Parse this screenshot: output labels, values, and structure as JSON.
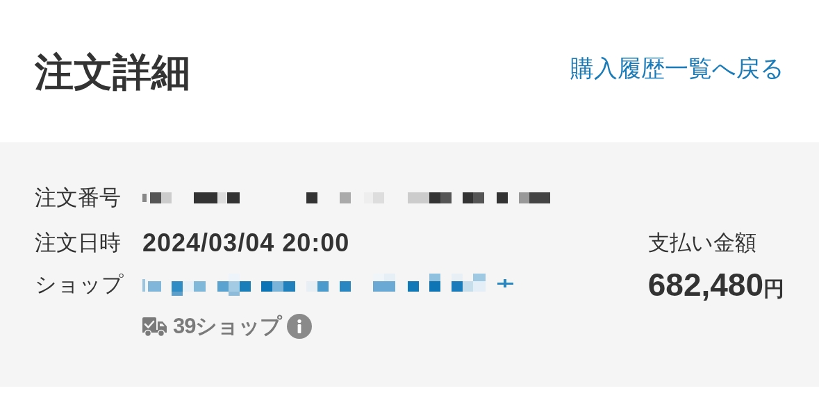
{
  "header": {
    "title": "注文詳細",
    "back_link": "購入履歴一覧へ戻る"
  },
  "order": {
    "fields": [
      {
        "kind": "redacted",
        "label": "注文番号"
      },
      {
        "kind": "text",
        "label": "注文日時",
        "value": "2024/03/04 20:00"
      },
      {
        "kind": "redacted_link",
        "label": "ショップ"
      }
    ],
    "badge": {
      "label": "39ショップ"
    },
    "payment": {
      "label": "支払い金額",
      "amount": "682,480",
      "currency": "円"
    }
  }
}
